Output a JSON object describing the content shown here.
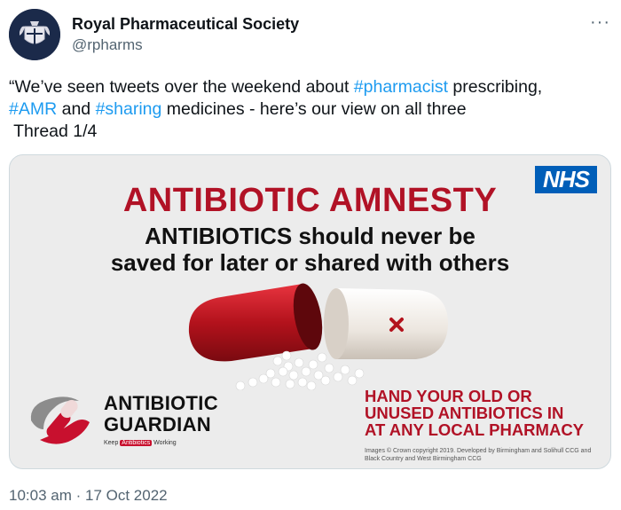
{
  "account": {
    "name": "Royal Pharmaceutical Society",
    "handle": "@rpharms",
    "more_icon": "more-horizontal-icon"
  },
  "tweet": {
    "line1_a": "“We’ve seen tweets over the weekend about ",
    "line1_tag": "#pharmacist",
    "line1_b": " prescribing,",
    "line2_tag1": "#AMR",
    "line2_a": " and ",
    "line2_tag2": "#sharing",
    "line2_b": " medicines - here’s our view on all three",
    "line3": " Thread 1/4"
  },
  "image": {
    "nhs_logo": "NHS",
    "headline": "ANTIBIOTIC AMNESTY",
    "subhead_line1": "ANTIBIOTICS should never be",
    "subhead_line2": "saved for later or shared with others",
    "guardian_line1": "ANTIBIOTIC",
    "guardian_line2": "GUARDIAN",
    "kaw_pre": "Keep ",
    "kaw_box": "Antibiotics",
    "kaw_post": " Working",
    "cta_line1": "HAND YOUR OLD OR",
    "cta_line2": "UNUSED ANTIBIOTICS IN",
    "cta_line3": "AT ANY LOCAL PHARMACY",
    "copyright": "Images © Crown copyright 2019.  Developed by Birmingham and Solihull CCG and Black Country and West Birmingham CCG"
  },
  "timestamp": "10:03 am · 17 Oct 2022",
  "colors": {
    "link": "#1d9bf0",
    "nhs_blue": "#005eb8",
    "headline_red": "#b11226"
  }
}
